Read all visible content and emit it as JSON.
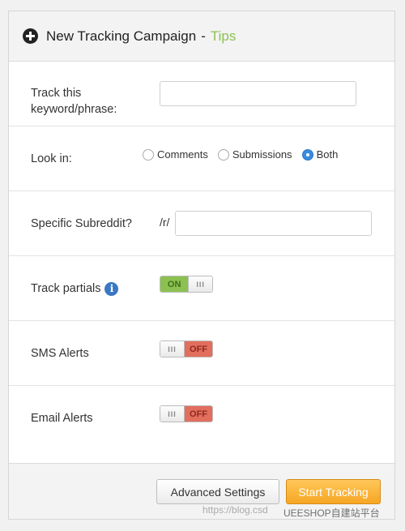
{
  "header": {
    "title": "New Tracking Campaign",
    "separator": "-",
    "tips_link": "Tips",
    "icon": "plus-circle-icon"
  },
  "keyword": {
    "label_line1": "Track this",
    "label_line2": "keyword/phrase:",
    "value": "",
    "placeholder": ""
  },
  "look_in": {
    "label": "Look in:",
    "options": [
      "Comments",
      "Submissions",
      "Both"
    ],
    "selected": "Both"
  },
  "subreddit": {
    "label": "Specific Subreddit?",
    "prefix": "/r/",
    "value": ""
  },
  "track_partials": {
    "label": "Track partials",
    "info_icon": "info-icon",
    "state_text": "ON",
    "knob_text": "III"
  },
  "sms_alerts": {
    "label": "SMS Alerts",
    "state_text": "OFF",
    "knob_text": "III"
  },
  "email_alerts": {
    "label": "Email Alerts",
    "state_text": "OFF",
    "knob_text": "III"
  },
  "footer": {
    "advanced_label": "Advanced Settings",
    "start_label": "Start Tracking"
  },
  "watermark": {
    "url_text": "https://blog.csd",
    "brand_text": "UEESHOP自建站平台"
  },
  "colors": {
    "accent_green": "#8cc152",
    "accent_orange": "#f6a623",
    "toggle_off_red": "#e26e5e",
    "radio_blue": "#3b8be0"
  }
}
